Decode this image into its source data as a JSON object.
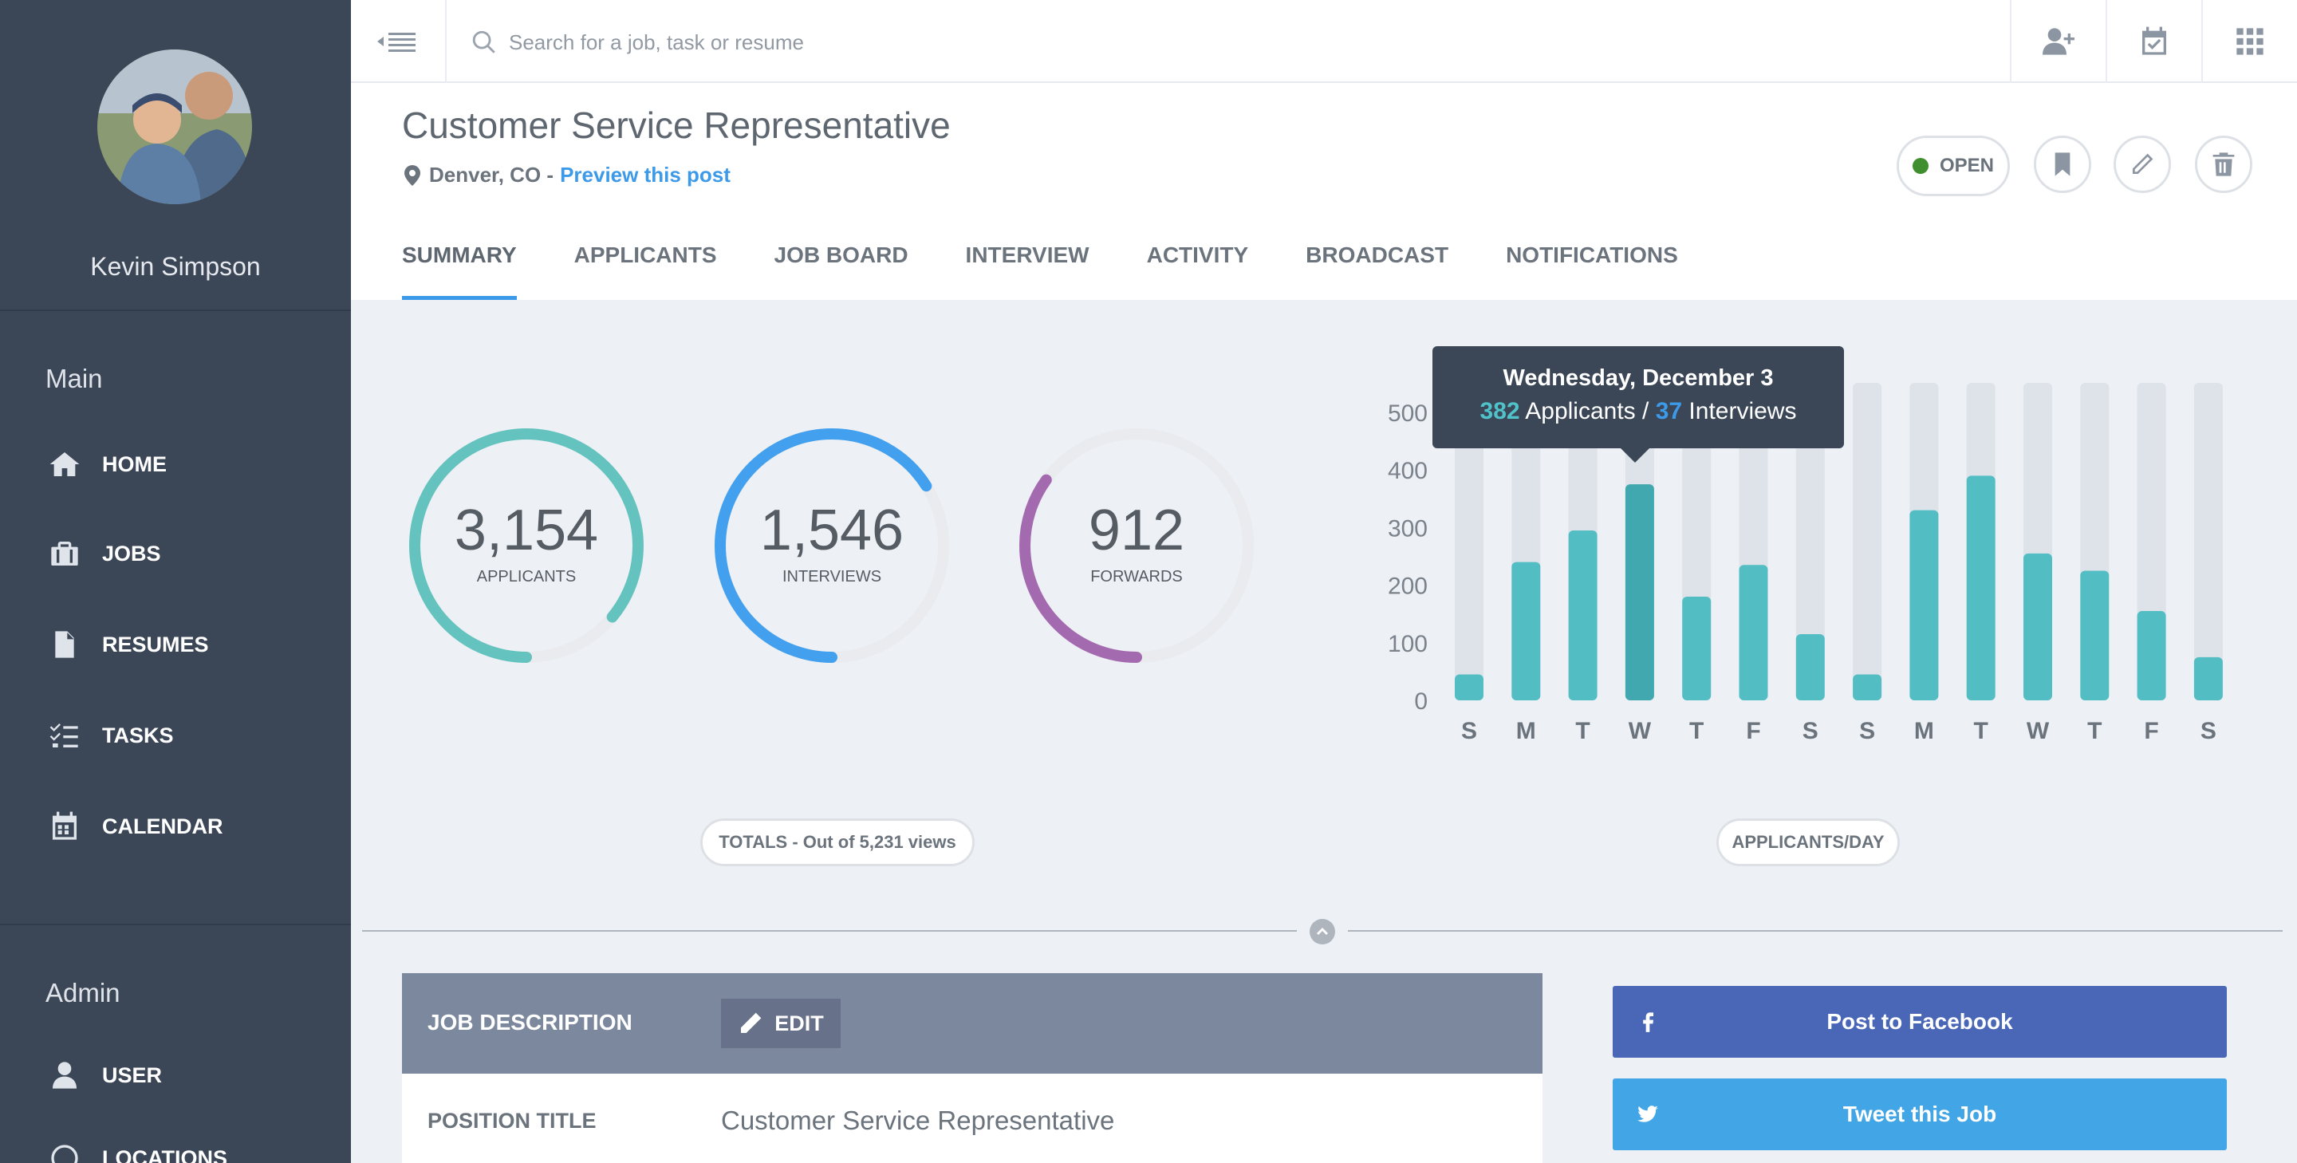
{
  "user": {
    "name": "Kevin Simpson"
  },
  "sidebar": {
    "main_label": "Main",
    "main_items": [
      {
        "label": "HOME",
        "icon": "home-icon"
      },
      {
        "label": "JOBS",
        "icon": "briefcase-icon"
      },
      {
        "label": "RESUMES",
        "icon": "document-icon"
      },
      {
        "label": "TASKS",
        "icon": "tasks-icon"
      },
      {
        "label": "CALENDAR",
        "icon": "calendar-icon"
      }
    ],
    "admin_label": "Admin",
    "admin_items": [
      {
        "label": "USER",
        "icon": "user-icon"
      },
      {
        "label": "LOCATIONS",
        "icon": "location-icon"
      }
    ]
  },
  "topbar": {
    "search_placeholder": "Search for a job, task or resume"
  },
  "job": {
    "title": "Customer Service Representative",
    "location": "Denver, CO -",
    "preview_link": "Preview this post",
    "status": "OPEN",
    "status_color": "#3f8f2e"
  },
  "tabs": [
    "SUMMARY",
    "APPLICANTS",
    "JOB BOARD",
    "INTERVIEW",
    "ACTIVITY",
    "BROADCAST",
    "NOTIFICATIONS"
  ],
  "active_tab": "SUMMARY",
  "totals": {
    "applicants": {
      "value": "3,154",
      "label": "APPLICANTS",
      "fraction": 0.86,
      "color": "#64c3bf"
    },
    "interviews": {
      "value": "1,546",
      "label": "INTERVIEWS",
      "fraction": 0.66,
      "color": "#42a0ee"
    },
    "forwards": {
      "value": "912",
      "label": "FORWARDS",
      "fraction": 0.35,
      "color": "#a46ab0"
    },
    "caption": "TOTALS - Out of 5,231 views"
  },
  "chart_data": {
    "type": "bar",
    "title": "",
    "caption": "APPLICANTS/DAY",
    "categories": [
      "S",
      "M",
      "T",
      "W",
      "T",
      "F",
      "S",
      "S",
      "M",
      "T",
      "W",
      "T",
      "F",
      "S"
    ],
    "series": [
      {
        "values": [
          45,
          240,
          295,
          375,
          180,
          235,
          115,
          45,
          330,
          390,
          255,
          225,
          155,
          75
        ]
      }
    ],
    "highlight_index": 3,
    "ylim": [
      0,
      540
    ],
    "yticks": [
      0,
      100,
      200,
      300,
      400,
      500
    ],
    "grid": false,
    "colors": {
      "bar": "#52bec4",
      "highlight": "#40a8ae",
      "track": "#dde3e9"
    }
  },
  "tooltip": {
    "date": "Wednesday, December 3",
    "applicants": "382",
    "applicants_label": "Applicants /",
    "interviews": "37",
    "interviews_label": "Interviews"
  },
  "job_description": {
    "header": "JOB DESCRIPTION",
    "edit_label": "EDIT",
    "rows": [
      {
        "key": "POSITION TITLE",
        "value": "Customer Service Representative"
      }
    ]
  },
  "social": {
    "facebook": "Post to Facebook",
    "twitter": "Tweet this Job"
  }
}
